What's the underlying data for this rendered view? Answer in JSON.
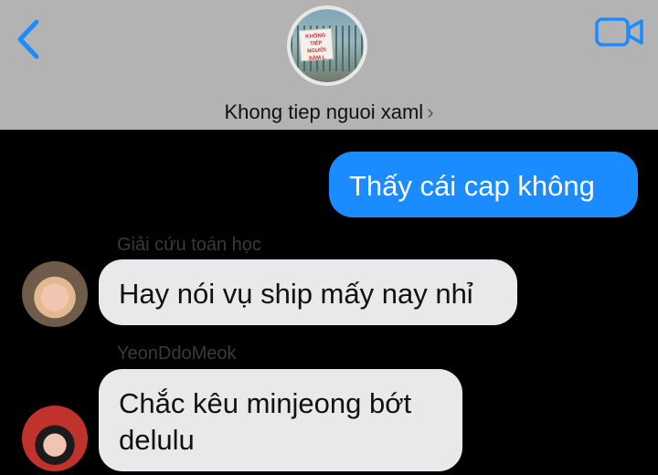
{
  "header": {
    "group_name": "Khong tiep nguoi xaml",
    "group_avatar_sign_text": "KHÔNG TIẾP NGƯỜI XÀM L",
    "chevron": "›",
    "icons": {
      "back": "chevron-left-icon",
      "video": "video-camera-icon"
    },
    "accent_color": "#1a8cff",
    "header_bg": "#b3b3b3"
  },
  "messages": [
    {
      "direction": "outgoing",
      "text": "Thấy cái cap không",
      "color": "#1a8cff"
    },
    {
      "direction": "incoming",
      "sender": "Giải cứu toán học",
      "text": "Hay nói vụ ship mấy nay nhỉ"
    },
    {
      "direction": "incoming",
      "sender": "YeonDdoMeok",
      "text_line1": "Chắc kêu minjeong bớt",
      "text_line2": "delulu"
    }
  ]
}
